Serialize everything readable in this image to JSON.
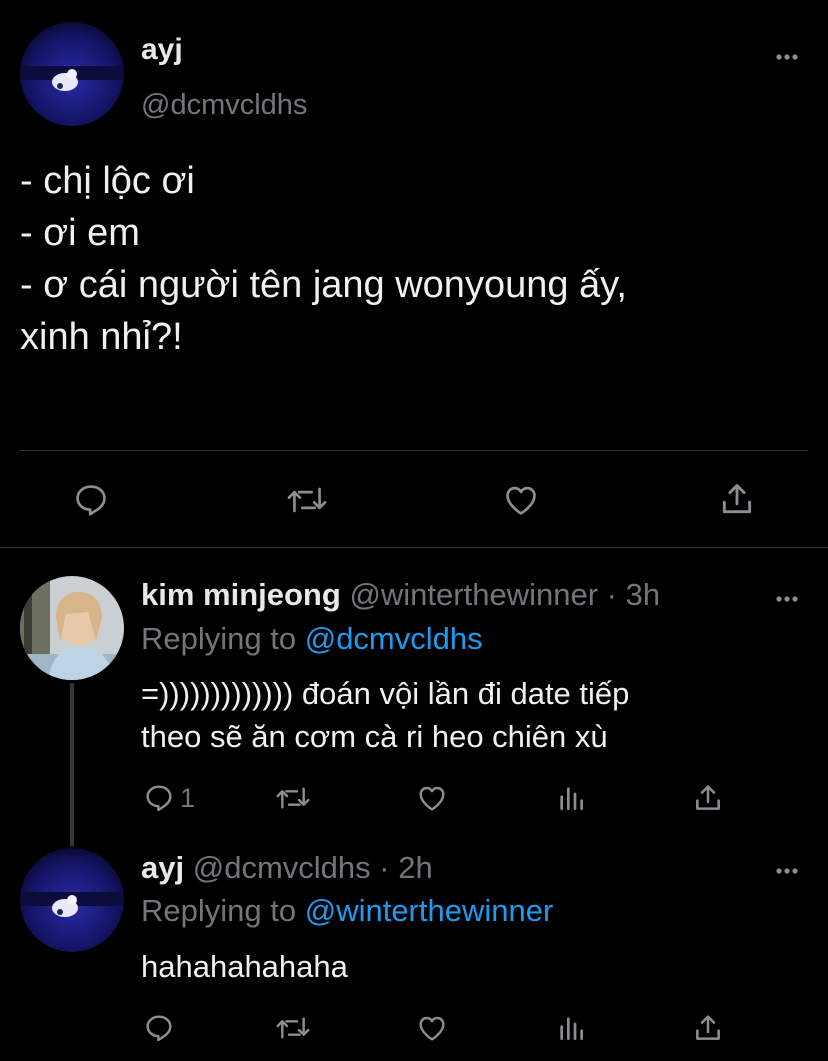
{
  "main_tweet": {
    "display_name": "ayj",
    "handle": "@dcmvcldhs",
    "lines": [
      "- chị lộc ơi",
      "- ơi em",
      "- ơ cái người tên jang wonyoung ấy,",
      "xinh nhỉ?!"
    ]
  },
  "replies": [
    {
      "display_name": "kim minjeong",
      "handle": "@winterthewinner",
      "time": "· 3h",
      "replying_prefix": "Replying to ",
      "replying_to": "@dcmvcldhs",
      "lines": [
        "=))))))))))))) đoán vội lần đi date tiếp",
        "theo sẽ ăn cơm cà ri heo chiên xù"
      ],
      "reply_count": "1"
    },
    {
      "display_name": "ayj",
      "handle": "@dcmvcldhs",
      "time": "· 2h",
      "replying_prefix": "Replying to ",
      "replying_to": "@winterthewinner",
      "lines": [
        "hahahahahaha"
      ],
      "reply_count": ""
    }
  ],
  "icons": {
    "reply": "reply-icon",
    "retweet": "retweet-icon",
    "like": "like-icon",
    "share": "share-icon",
    "analytics": "analytics-icon",
    "more": "more-icon"
  },
  "colors": {
    "background": "#000000",
    "text": "#e7e9ea",
    "muted": "#71767b",
    "link": "#1d9bf0",
    "divider": "#2f3336"
  }
}
